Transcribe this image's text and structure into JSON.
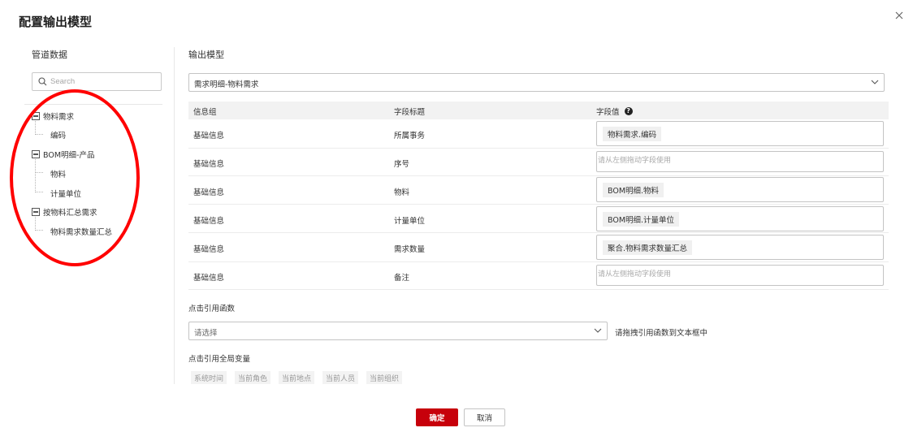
{
  "dialog": {
    "title": "配置输出模型"
  },
  "left": {
    "title": "管道数据",
    "search_placeholder": "Search",
    "tree": [
      {
        "label": "物料需求",
        "children": [
          "编码"
        ]
      },
      {
        "label": "BOM明细-产品",
        "children": [
          "物料",
          "计量单位"
        ]
      },
      {
        "label": "按物料汇总需求",
        "children": [
          "物料需求数量汇总"
        ]
      }
    ]
  },
  "right": {
    "title": "输出模型",
    "model_select": "需求明细-物料需求",
    "table": {
      "headers": [
        "信息组",
        "字段标题",
        "字段值"
      ],
      "help_glyph": "?",
      "rows": [
        {
          "group": "基础信息",
          "field": "所属事务",
          "value": "物料需求.编码",
          "placeholder": ""
        },
        {
          "group": "基础信息",
          "field": "序号",
          "value": "",
          "placeholder": "请从左侧拖动字段使用"
        },
        {
          "group": "基础信息",
          "field": "物料",
          "value": "BOM明细.物料",
          "placeholder": ""
        },
        {
          "group": "基础信息",
          "field": "计量单位",
          "value": "BOM明细.计量单位",
          "placeholder": ""
        },
        {
          "group": "基础信息",
          "field": "需求数量",
          "value": "聚合.物料需求数量汇总",
          "placeholder": ""
        },
        {
          "group": "基础信息",
          "field": "备注",
          "value": "",
          "placeholder": "请从左侧拖动字段使用"
        }
      ]
    },
    "function": {
      "label": "点击引用函数",
      "select_placeholder": "请选择",
      "hint": "请拖拽引用函数到文本框中"
    },
    "global_vars": {
      "label": "点击引用全局变量",
      "items": [
        "系统时间",
        "当前角色",
        "当前地点",
        "当前人员",
        "当前组织"
      ]
    }
  },
  "footer": {
    "ok_label": "确定",
    "cancel_label": "取消"
  },
  "colors": {
    "primary": "#c7000b",
    "annotation": "#ff0000"
  }
}
